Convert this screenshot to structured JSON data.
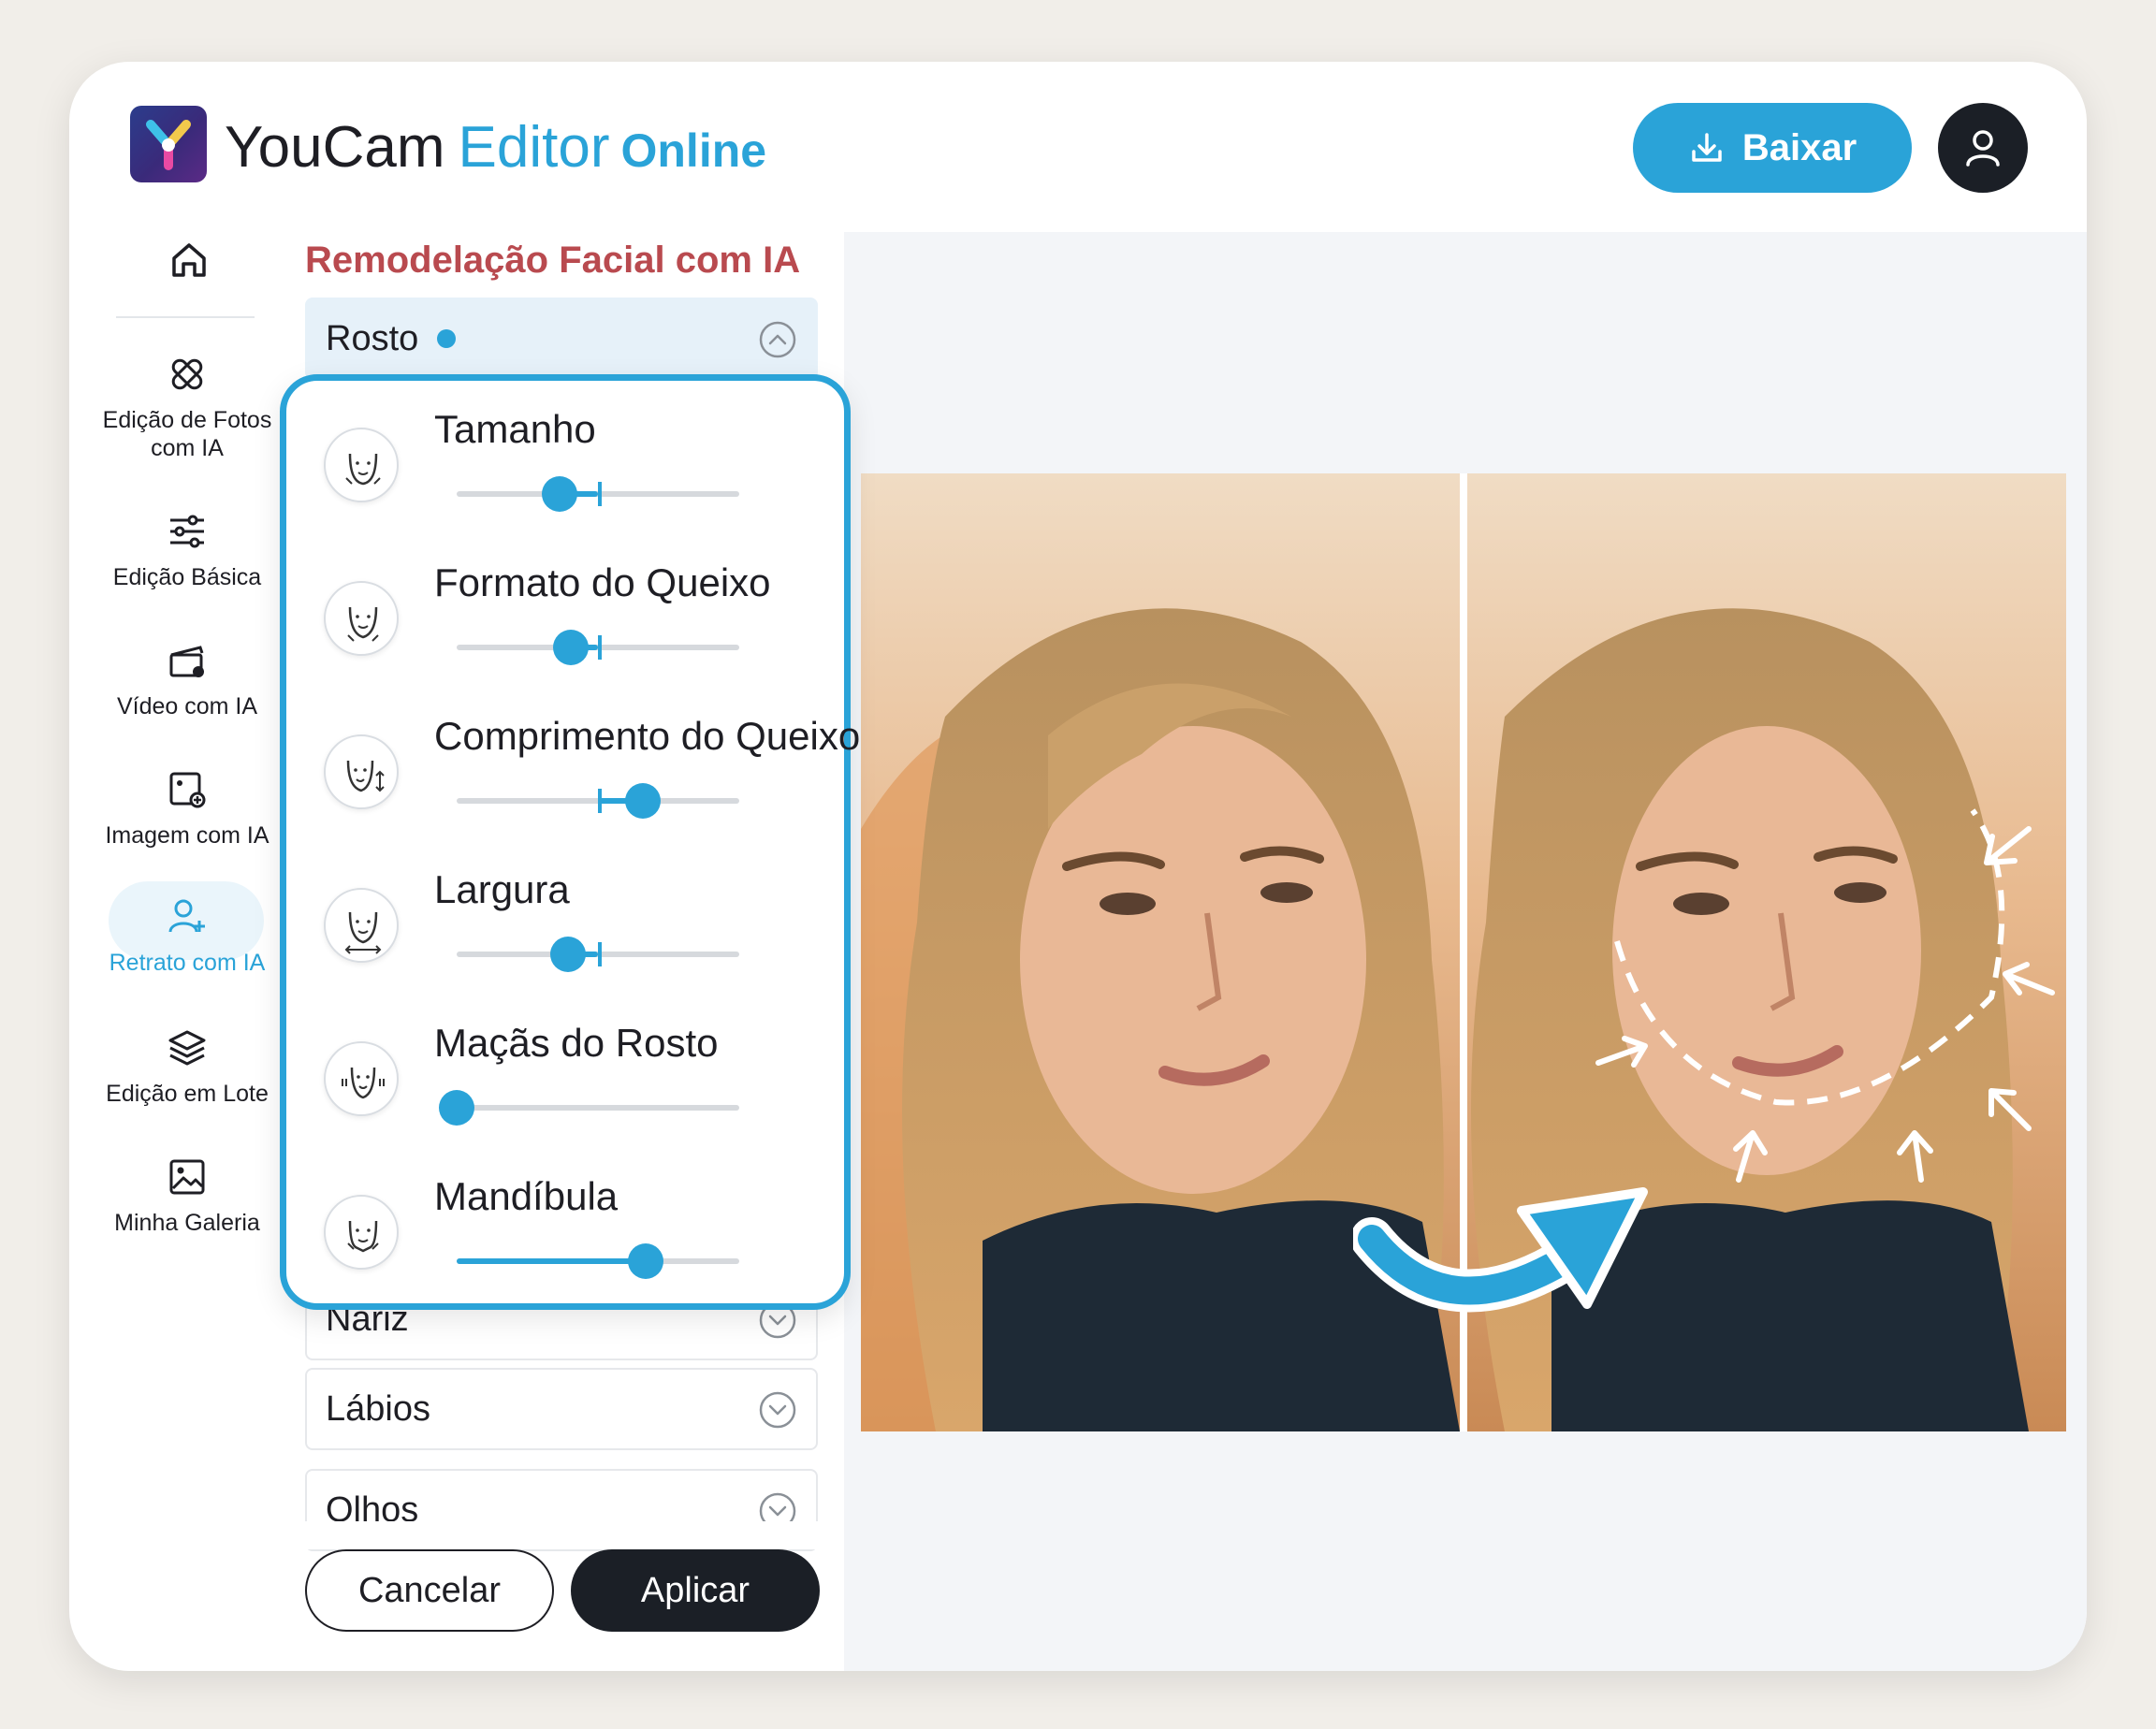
{
  "header": {
    "brand_word1": "YouCam",
    "brand_word2": "Editor",
    "brand_word3": "Online",
    "download_label": "Baixar"
  },
  "sidebar": {
    "items": [
      {
        "id": "home",
        "label": "",
        "icon": "home-icon"
      },
      {
        "id": "photo-ai",
        "label": "Edição de Fotos com IA",
        "icon": "bandage-icon"
      },
      {
        "id": "basic",
        "label": "Edição Básica",
        "icon": "sliders-icon"
      },
      {
        "id": "video",
        "label": "Vídeo com IA",
        "icon": "clapperboard-icon"
      },
      {
        "id": "image",
        "label": "Imagem com IA",
        "icon": "image-sparkle-icon"
      },
      {
        "id": "portrait",
        "label": "Retrato com IA",
        "icon": "user-add-icon",
        "active": true
      },
      {
        "id": "batch",
        "label": "Edição em Lote",
        "icon": "layers-icon"
      },
      {
        "id": "gallery",
        "label": "Minha Galeria",
        "icon": "gallery-icon"
      }
    ]
  },
  "panel": {
    "title": "Remodelação Facial com IA",
    "sections": [
      {
        "label": "Rosto",
        "expanded": true,
        "indicator": true
      },
      {
        "label": "Nariz",
        "expanded": false
      },
      {
        "label": "Lábios",
        "expanded": false
      },
      {
        "label": "Olhos",
        "expanded": false
      }
    ],
    "sliders": [
      {
        "label": "Tamanho",
        "value": -27,
        "min": -100,
        "max": 100,
        "icon": "face-size-icon"
      },
      {
        "label": "Formato do Queixo",
        "value": -19,
        "min": -100,
        "max": 100,
        "icon": "chin-shape-icon"
      },
      {
        "label": "Comprimento do Queixo",
        "value": 32,
        "min": -100,
        "max": 100,
        "icon": "chin-length-icon"
      },
      {
        "label": "Largura",
        "value": -21,
        "min": -100,
        "max": 100,
        "icon": "face-width-icon"
      },
      {
        "label": "Maçãs do Rosto",
        "value": 0,
        "min": 0,
        "max": 100,
        "icon": "cheekbones-icon"
      },
      {
        "label": "Mandíbula",
        "value": 67,
        "min": 0,
        "max": 100,
        "icon": "jawline-icon"
      }
    ],
    "cancel_label": "Cancelar",
    "apply_label": "Aplicar"
  },
  "colors": {
    "accent": "#2aa3d8",
    "title_red": "#b94a4f",
    "dark": "#1b1f26"
  }
}
